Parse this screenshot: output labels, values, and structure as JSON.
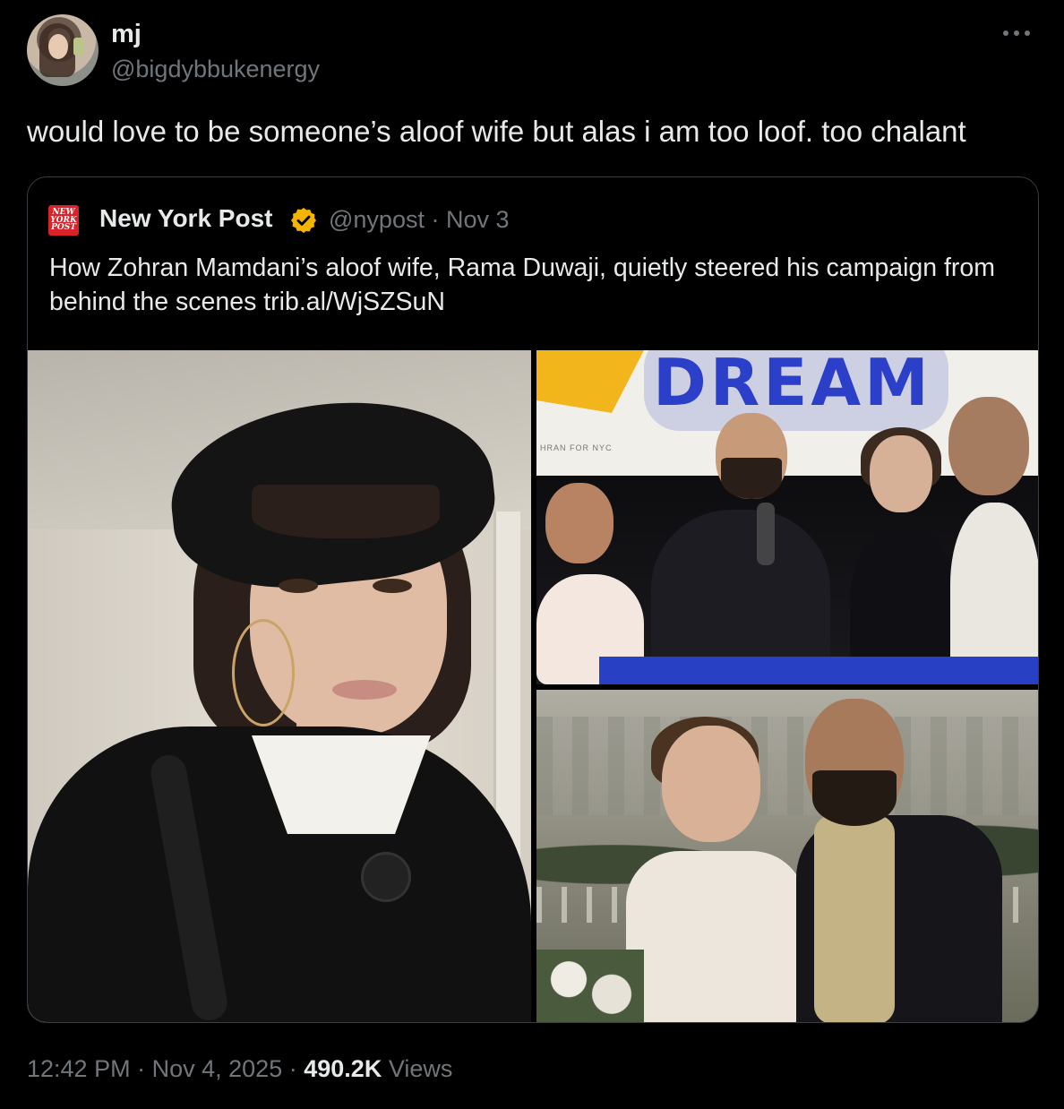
{
  "author": {
    "display_name": "mj",
    "handle": "@bigdybbukenergy"
  },
  "tweet": {
    "text": "would love to be someone’s aloof wife but alas i am too loof. too chalant"
  },
  "quoted": {
    "logo_lines": [
      "NEW",
      "YORK",
      "POST"
    ],
    "display_name": "New York Post",
    "handle": "@nypost",
    "separator": "·",
    "date": "Nov 3",
    "text": "How Zohran Mamdani’s aloof wife, Rama Duwaji, quietly steered his campaign from behind the scenes trib.al/WjSZSuN",
    "images": {
      "top_right_banner_text": "DREAM",
      "top_right_banner_small": "HRAN FOR NYC"
    },
    "verified_color": "#f4b400"
  },
  "footer": {
    "time": "12:42 PM",
    "sep1": "·",
    "date": "Nov 4, 2025",
    "sep2": "·",
    "views_count": "490.2K",
    "views_label": "Views"
  },
  "colors": {
    "background": "#000000",
    "text_primary": "#e7e9ea",
    "text_secondary": "#71767b",
    "border": "#3a3d41",
    "nypost_red": "#d9232a"
  }
}
